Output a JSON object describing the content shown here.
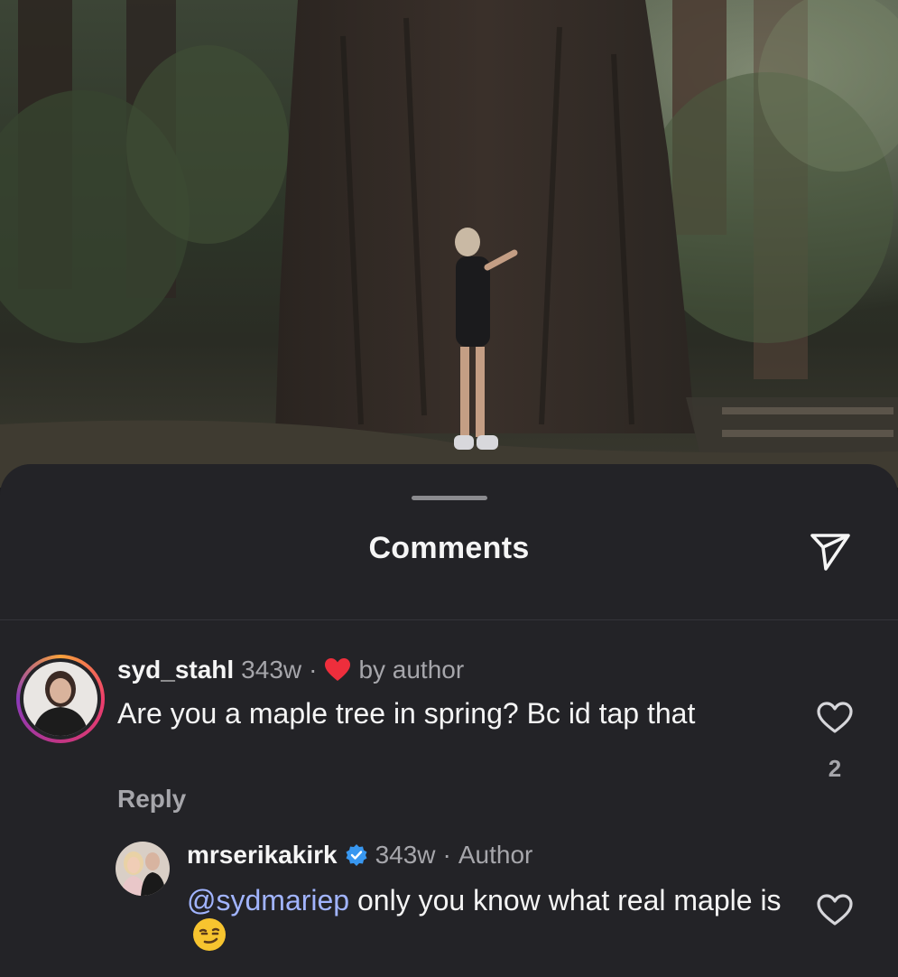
{
  "photo": {
    "alt_icon": "forest-photo"
  },
  "sheet": {
    "title": "Comments",
    "share_icon": "send-icon"
  },
  "comments": [
    {
      "username": "syd_stahl",
      "age": "343w",
      "separator": "·",
      "liked_by_author_icon": "heart-filled-icon",
      "liked_by_author_label": "by author",
      "text": "Are you a maple tree in spring? Bc id tap that",
      "reply_label": "Reply",
      "like_icon": "heart-outline-icon",
      "like_count": "2"
    },
    {
      "username": "mrserikakirk",
      "verified_icon": "verified-badge-icon",
      "age": "343w",
      "separator": "·",
      "author_label": "Author",
      "mention": "@sydmariep",
      "text": "only you know what real maple is",
      "emoji": "smirking-face-emoji",
      "like_icon": "heart-outline-icon"
    }
  ],
  "colors": {
    "sheet_bg": "#232327",
    "mention": "#a1b4ff",
    "heart_red": "#ee2e3c",
    "verified_blue": "#3897f0"
  }
}
